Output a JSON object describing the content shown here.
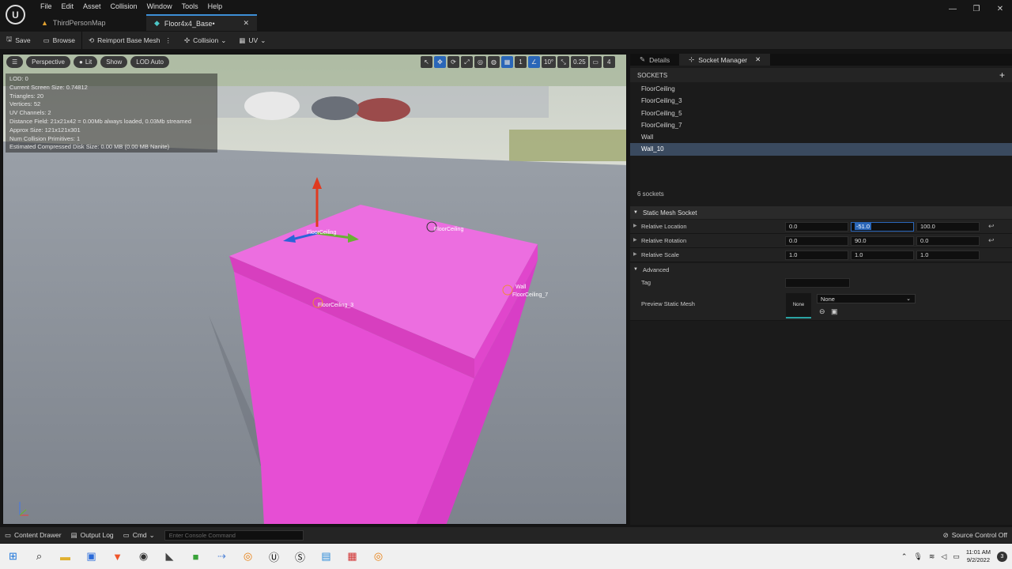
{
  "menu": [
    "File",
    "Edit",
    "Asset",
    "Collision",
    "Window",
    "Tools",
    "Help"
  ],
  "tabs": [
    {
      "label": "ThirdPersonMap"
    },
    {
      "label": "Floor4x4_Base•"
    }
  ],
  "toolbar": {
    "save": "Save",
    "browse": "Browse",
    "reimport": "Reimport Base Mesh",
    "collision": "Collision",
    "uv": "UV"
  },
  "viewport": {
    "perspective": "Perspective",
    "lit": "Lit",
    "show": "Show",
    "lod": "LOD Auto",
    "grid_value": "1",
    "angle_value": "10°",
    "scale_value": "0.25",
    "camera_value": "4",
    "stats": [
      "LOD:  0",
      "Current Screen Size:  0.74812",
      "Triangles:  20",
      "Vertices:  52",
      "UV Channels:  2",
      "Distance Field:  21x21x42 = 0.00Mb always loaded, 0.03Mb streamed",
      "Approx Size:  121x121x301",
      "Num Collision Primitives:  1",
      "Estimated Compressed Disk Size: 0.00 MB (0.00 MB Nanite)"
    ],
    "socket_labels": {
      "top_left": "FloorCeiling",
      "top_right": "FloorCeiling",
      "front": "FloorCeiling_3",
      "side_wall": "Wall",
      "side_floor": "FloorCeiling_7"
    },
    "mesh_color": "#e85fd8"
  },
  "right_panel": {
    "tabs": [
      "Details",
      "Socket Manager"
    ],
    "sockets_header": "SOCKETS",
    "sockets": [
      "FloorCeiling",
      "FloorCeiling_3",
      "FloorCeiling_5",
      "FloorCeiling_7",
      "Wall",
      "Wall_10"
    ],
    "selected_socket": "Wall_10",
    "socket_count": "6 sockets",
    "category": "Static Mesh Socket",
    "rows": [
      {
        "label": "Relative Location",
        "values": [
          "0.0",
          "-51.0",
          "100.0"
        ]
      },
      {
        "label": "Relative Rotation",
        "values": [
          "0.0",
          "90.0",
          "0.0"
        ]
      },
      {
        "label": "Relative Scale",
        "values": [
          "1.0",
          "1.0",
          "1.0"
        ]
      }
    ],
    "advanced": "Advanced",
    "tag_label": "Tag",
    "tag_value": "",
    "preview_label": "Preview Static Mesh",
    "preview_thumb": "None",
    "preview_value": "None"
  },
  "bottom": {
    "content_drawer": "Content Drawer",
    "output_log": "Output Log",
    "cmd": "Cmd",
    "console_placeholder": "Enter Console Command",
    "source_control": "Source Control Off"
  },
  "taskbar": {
    "time": "11:01 AM",
    "date": "9/2/2022",
    "notif": "3"
  }
}
